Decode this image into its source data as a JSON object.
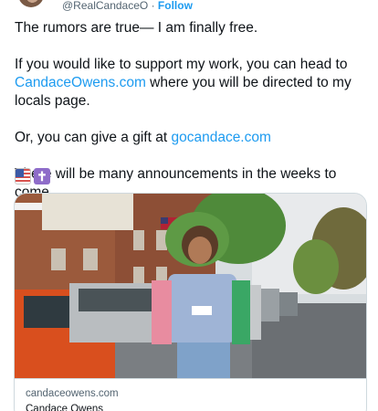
{
  "author": {
    "handle": "@RealCandaceO",
    "separator": " · ",
    "follow_label": "Follow"
  },
  "tweet": {
    "line1": "The rumors are true— I am finally free.",
    "p2_before": "If you would like to support my work, you can head to ",
    "p2_link": "CandaceOwens.com",
    "p2_after": " where you will be directed to my locals page.",
    "p3_before": "Or, you can give a gift at ",
    "p3_link": "gocandace.com",
    "p4": "There will be many announcements in the weeks to come.",
    "emojis": [
      "flag-united-states",
      "latin-cross"
    ]
  },
  "card": {
    "domain": "candaceowens.com",
    "title": "Candace Owens"
  }
}
